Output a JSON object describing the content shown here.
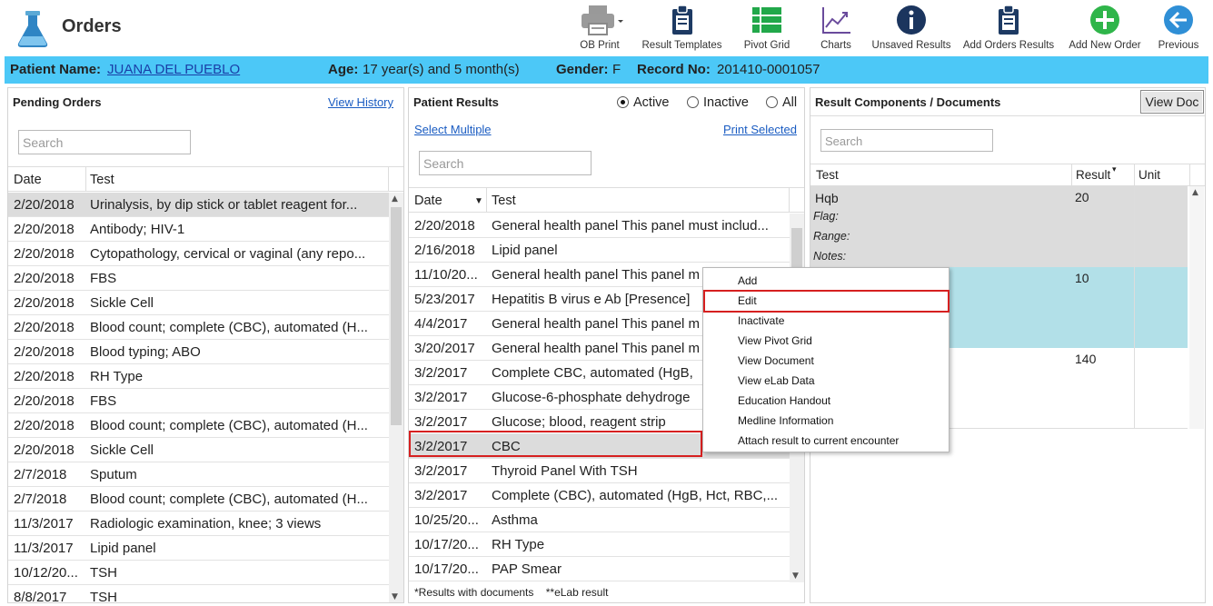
{
  "app": {
    "title": "Orders"
  },
  "toolbar": [
    {
      "label": "OB Print",
      "icon": "printer-icon"
    },
    {
      "label": "Result Templates",
      "icon": "clipboard-icon"
    },
    {
      "label": "Pivot Grid",
      "icon": "grid-icon"
    },
    {
      "label": "Charts",
      "icon": "chart-icon"
    },
    {
      "label": "Unsaved Results",
      "icon": "info-icon"
    },
    {
      "label": "Add Orders Results",
      "icon": "clipboard-add-icon"
    },
    {
      "label": "Add New Order",
      "icon": "plus-icon"
    },
    {
      "label": "Previous",
      "icon": "back-arrow-icon"
    }
  ],
  "patient": {
    "name_label": "Patient Name:",
    "name": "JUANA DEL PUEBLO",
    "age_label": "Age:",
    "age": "17 year(s) and 5 month(s)",
    "gender_label": "Gender:",
    "gender": "F",
    "record_label": "Record No:",
    "record": "201410-0001057"
  },
  "pending": {
    "title": "Pending Orders",
    "history_link": "View History",
    "search_placeholder": "Search",
    "col_date": "Date",
    "col_test": "Test",
    "rows": [
      {
        "date": "2/20/2018",
        "test": "Urinalysis, by dip stick or tablet reagent for..."
      },
      {
        "date": "2/20/2018",
        "test": "Antibody; HIV-1"
      },
      {
        "date": "2/20/2018",
        "test": "Cytopathology, cervical or vaginal (any repo..."
      },
      {
        "date": "2/20/2018",
        "test": "FBS"
      },
      {
        "date": "2/20/2018",
        "test": "Sickle Cell"
      },
      {
        "date": "2/20/2018",
        "test": "Blood count; complete (CBC), automated (H..."
      },
      {
        "date": "2/20/2018",
        "test": "Blood typing; ABO"
      },
      {
        "date": "2/20/2018",
        "test": "RH Type"
      },
      {
        "date": "2/20/2018",
        "test": "FBS"
      },
      {
        "date": "2/20/2018",
        "test": "Blood count; complete (CBC), automated (H..."
      },
      {
        "date": "2/20/2018",
        "test": "Sickle Cell"
      },
      {
        "date": "2/7/2018",
        "test": "Sputum"
      },
      {
        "date": "2/7/2018",
        "test": "Blood count; complete (CBC), automated (H..."
      },
      {
        "date": "11/3/2017",
        "test": "Radiologic examination, knee; 3 views"
      },
      {
        "date": "11/3/2017",
        "test": "Lipid panel"
      },
      {
        "date": "10/12/20...",
        "test": "TSH"
      },
      {
        "date": "8/8/2017",
        "test": "TSH"
      }
    ]
  },
  "results": {
    "title": "Patient Results",
    "radio_active": "Active",
    "radio_inactive": "Inactive",
    "radio_all": "All",
    "select_multiple": "Select Multiple",
    "print_selected": "Print Selected",
    "search_placeholder": "Search",
    "col_date": "Date",
    "col_test": "Test",
    "footer": "*Results with documents    **eLab result",
    "rows": [
      {
        "date": "2/20/2018",
        "test": "General health panel This panel must includ..."
      },
      {
        "date": "2/16/2018",
        "test": "Lipid panel"
      },
      {
        "date": "11/10/20...",
        "test": "General health panel This panel m"
      },
      {
        "date": "5/23/2017",
        "test": "Hepatitis B virus e Ab [Presence]"
      },
      {
        "date": "4/4/2017",
        "test": "General health panel This panel m"
      },
      {
        "date": "3/20/2017",
        "test": "General health panel This panel m"
      },
      {
        "date": "3/2/2017",
        "test": "Complete CBC, automated (HgB, "
      },
      {
        "date": "3/2/2017",
        "test": "Glucose-6-phosphate dehydroge"
      },
      {
        "date": "3/2/2017",
        "test": "Glucose; blood, reagent strip"
      },
      {
        "date": "3/2/2017",
        "test": "CBC"
      },
      {
        "date": "3/2/2017",
        "test": "Thyroid Panel With TSH"
      },
      {
        "date": "3/2/2017",
        "test": "Complete (CBC), automated (HgB, Hct, RBC,..."
      },
      {
        "date": "10/25/20...",
        "test": "Asthma"
      },
      {
        "date": "10/17/20...",
        "test": "RH Type"
      },
      {
        "date": "10/17/20...",
        "test": "PAP Smear"
      }
    ]
  },
  "components": {
    "title": "Result Components / Documents",
    "view_doc": "View Doc",
    "search_placeholder": "Search",
    "col_test": "Test",
    "col_result": "Result",
    "col_unit": "Unit",
    "row1": {
      "name": "Hqb",
      "value": "20",
      "flag": "Flag:",
      "range": "Range:",
      "notes": "Notes:"
    },
    "row2": {
      "value": "10"
    },
    "row3": {
      "value": "140"
    }
  },
  "context_menu": {
    "items": [
      "Add",
      "Edit",
      "Inactivate",
      "View Pivot Grid",
      "View Document",
      "View eLab Data",
      "Education Handout",
      "Medline Information",
      "Attach result to current encounter"
    ]
  },
  "colors": {
    "patient_bar": "#4cc8f7",
    "highlight": "#d62020",
    "selected_row": "#dcdcdc",
    "component_selected": "#b2e0e8"
  }
}
